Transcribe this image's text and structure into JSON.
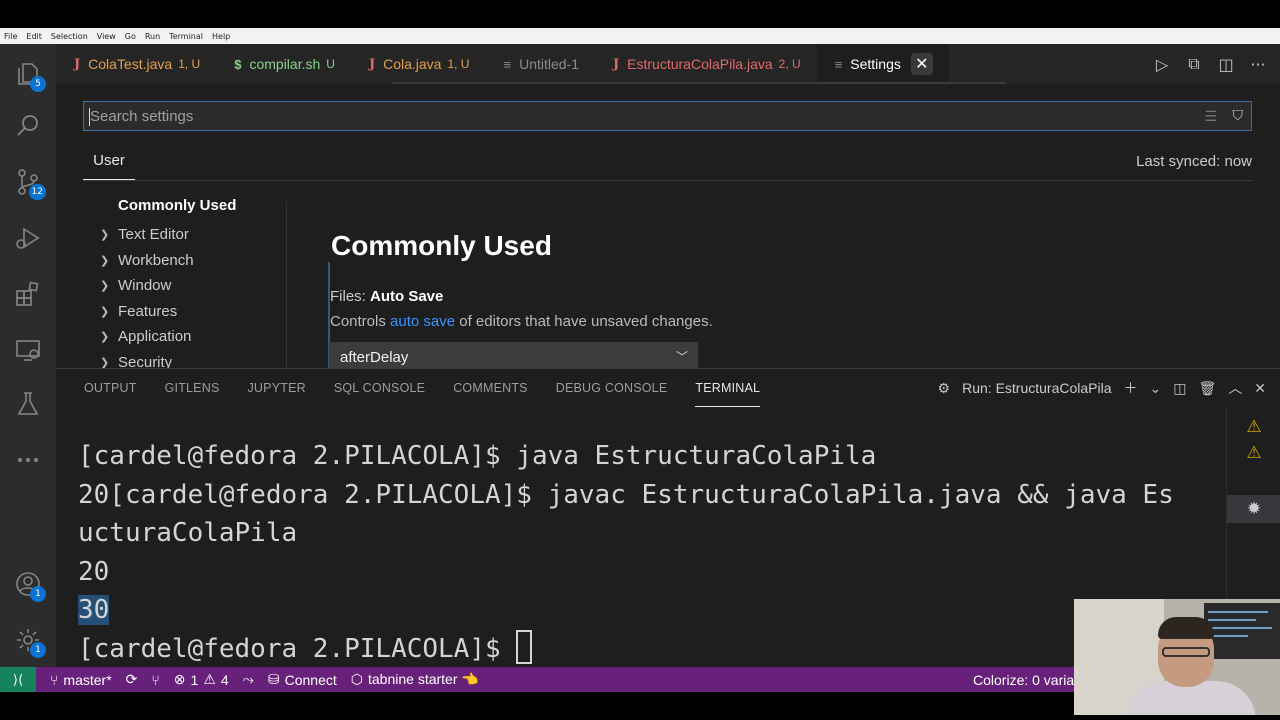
{
  "menu": [
    "File",
    "Edit",
    "Selection",
    "View",
    "Go",
    "Run",
    "Terminal",
    "Help"
  ],
  "activity": {
    "explorer_badge": "5",
    "scm_badge": "12",
    "accounts_badge": "1",
    "manage_badge": "1"
  },
  "tabs": [
    {
      "name": "ColaTest.java",
      "status": "1, U",
      "icon": "J"
    },
    {
      "name": "compilar.sh",
      "status": "U",
      "icon": "$"
    },
    {
      "name": "Cola.java",
      "status": "1, U",
      "icon": "J"
    },
    {
      "name": "Untitled-1",
      "status": "",
      "icon": "≡"
    },
    {
      "name": "EstructuraColaPila.java",
      "status": "2, U",
      "icon": "J"
    },
    {
      "name": "Settings",
      "status": "",
      "icon": "≡"
    }
  ],
  "settings": {
    "search_placeholder": "Search settings",
    "scope_tab": "User",
    "synced": "Last synced: now",
    "toc_head": "Commonly Used",
    "toc": [
      "Text Editor",
      "Workbench",
      "Window",
      "Features",
      "Application",
      "Security"
    ],
    "section_title": "Commonly Used",
    "setting_category": "Files: ",
    "setting_name": "Auto Save",
    "desc_before": "Controls ",
    "desc_link": "auto save",
    "desc_after": " of editors that have unsaved changes.",
    "dropdown_value": "afterDelay"
  },
  "panel": {
    "tabs": [
      "OUTPUT",
      "GITLENS",
      "JUPYTER",
      "SQL CONSOLE",
      "COMMENTS",
      "DEBUG CONSOLE",
      "TERMINAL"
    ],
    "run_label": "Run: EstructuraColaPila"
  },
  "terminal": {
    "line1": "[cardel@fedora 2.PILACOLA]$ java EstructuraColaPila",
    "line2": "20[cardel@fedora 2.PILACOLA]$ javac EstructuraColaPila.java && java Es",
    "line3": "ucturaColaPila",
    "line4": "20",
    "line5": "30",
    "line6": "[cardel@fedora 2.PILACOLA]$ "
  },
  "statusbar": {
    "branch": "master*",
    "errors": "1",
    "warnings": "4",
    "connect": "Connect",
    "tabnine": "tabnine starter 👈",
    "colorize": "Colorize: 0 varia"
  },
  "colors": {
    "status_bar": "#68217a",
    "remote": "#16825d",
    "badge": "#0b74d3",
    "editor_bg": "#1e1e1e"
  }
}
